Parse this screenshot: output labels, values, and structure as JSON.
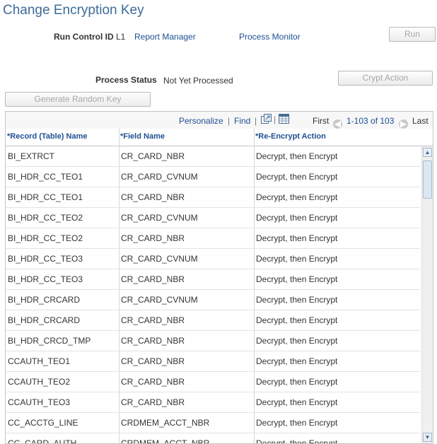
{
  "page_title": "Change Encryption Key",
  "run_control": {
    "label": "Run Control ID",
    "value": "L1"
  },
  "links": {
    "report_manager": "Report Manager",
    "process_monitor": "Process Monitor"
  },
  "buttons": {
    "run": "Run",
    "crypt_action": "Crypt Action",
    "generate_random_key": "Generate Random Key"
  },
  "process_status": {
    "label": "Process Status",
    "value": "Not Yet Processed"
  },
  "grid": {
    "nav": {
      "personalize": "Personalize",
      "separator": "|",
      "find": "Find",
      "first": "First",
      "range": "1-103 of 103",
      "last": "Last"
    },
    "headers": [
      "*Record (Table) Name",
      "*Field Name",
      "*Re-Encrypt Action"
    ],
    "rows": [
      [
        "BI_EXTRCT",
        "CR_CARD_NBR",
        "Decrypt, then Encrypt"
      ],
      [
        "BI_HDR_CC_TEO1",
        "CR_CARD_CVNUM",
        "Decrypt, then Encrypt"
      ],
      [
        "BI_HDR_CC_TEO1",
        "CR_CARD_NBR",
        "Decrypt, then Encrypt"
      ],
      [
        "BI_HDR_CC_TEO2",
        "CR_CARD_CVNUM",
        "Decrypt, then Encrypt"
      ],
      [
        "BI_HDR_CC_TEO2",
        "CR_CARD_NBR",
        "Decrypt, then Encrypt"
      ],
      [
        "BI_HDR_CC_TEO3",
        "CR_CARD_CVNUM",
        "Decrypt, then Encrypt"
      ],
      [
        "BI_HDR_CC_TEO3",
        "CR_CARD_NBR",
        "Decrypt, then Encrypt"
      ],
      [
        "BI_HDR_CRCARD",
        "CR_CARD_CVNUM",
        "Decrypt, then Encrypt"
      ],
      [
        "BI_HDR_CRCARD",
        "CR_CARD_NBR",
        "Decrypt, then Encrypt"
      ],
      [
        "BI_HDR_CRCD_TMP",
        "CR_CARD_NBR",
        "Decrypt, then Encrypt"
      ],
      [
        "CCAUTH_TEO1",
        "CR_CARD_NBR",
        "Decrypt, then Encrypt"
      ],
      [
        "CCAUTH_TEO2",
        "CR_CARD_NBR",
        "Decrypt, then Encrypt"
      ],
      [
        "CCAUTH_TEO3",
        "CR_CARD_NBR",
        "Decrypt, then Encrypt"
      ],
      [
        "CC_ACCTG_LINE",
        "CRDMEM_ACCT_NBR",
        "Decrypt, then Encrypt"
      ],
      [
        "CC_CARD_AUTH",
        "CRDMEM_ACCT_NBR",
        "Decrypt, then Encrypt"
      ]
    ]
  },
  "icons": {
    "zoom": "zoom-grid-icon",
    "download": "download-spreadsheet-icon",
    "prev": "previous-arrow-icon",
    "next": "next-arrow-icon",
    "scroll_up": "scroll-up-arrow-icon",
    "scroll_down": "scroll-down-arrow-icon"
  },
  "colors": {
    "title": "#3c6b9a",
    "link": "#1e4f91",
    "disabled_text": "#a7a7a7"
  }
}
